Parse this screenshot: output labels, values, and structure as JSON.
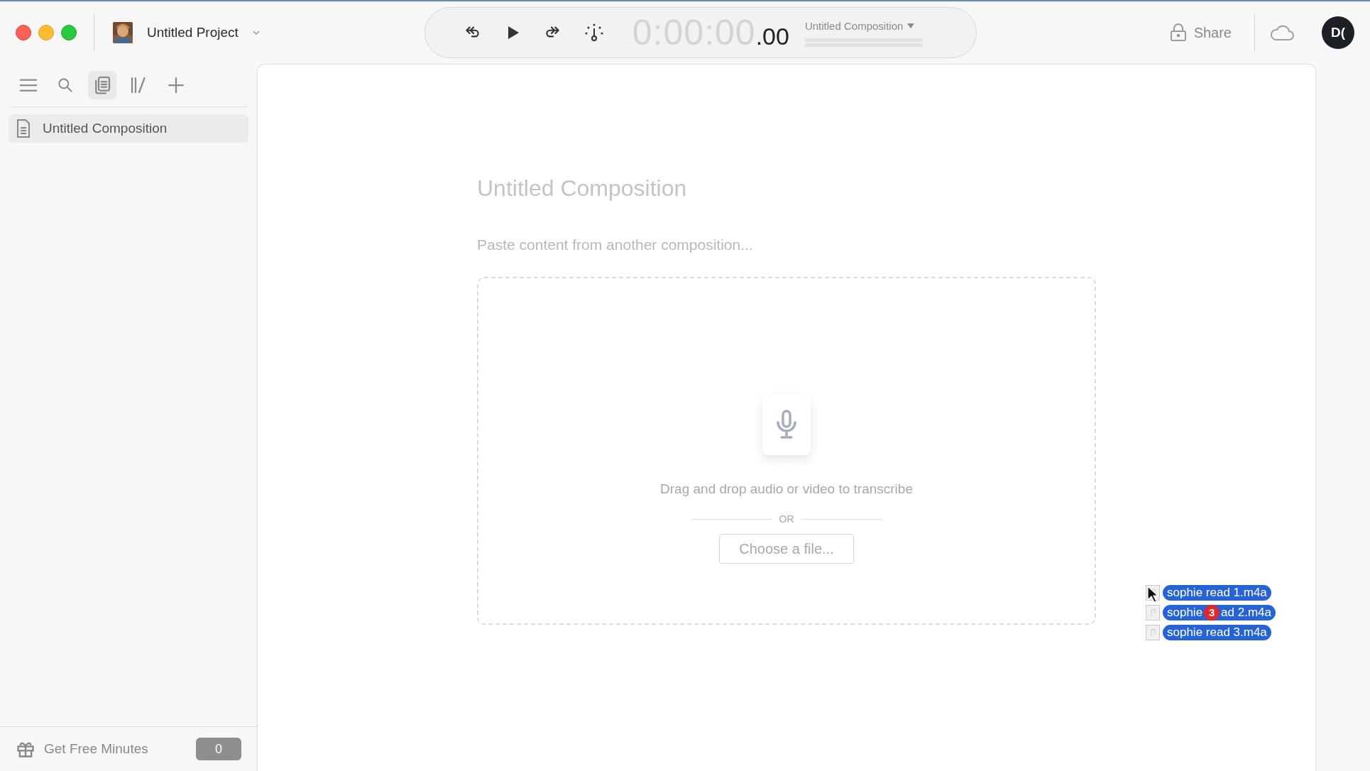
{
  "project": {
    "title": "Untitled Project"
  },
  "transport": {
    "time_main": "0:00:00",
    "time_fraction": ".00",
    "composition": "Untitled Composition"
  },
  "header": {
    "share": "Share",
    "avatar": "D("
  },
  "sidebar": {
    "tools": [
      {
        "kind": "menu",
        "selected": false
      },
      {
        "kind": "search",
        "selected": false
      },
      {
        "kind": "documents",
        "selected": true
      },
      {
        "kind": "library",
        "selected": false
      },
      {
        "kind": "add",
        "selected": false
      }
    ],
    "items": [
      {
        "label": "Untitled Composition",
        "selected": true
      }
    ],
    "footer": {
      "label": "Get Free Minutes",
      "count": "0"
    }
  },
  "editor": {
    "title": {
      "placeholder": "Untitled Composition"
    },
    "body": {
      "placeholder": "Paste content from another composition..."
    }
  },
  "dropzone": {
    "text": "Drag and drop audio or video to transcribe",
    "separator": "OR",
    "button": "Choose a file..."
  },
  "drag": {
    "count": "3",
    "files": [
      {
        "parts": [
          "sophie read 1.m4a"
        ]
      },
      {
        "parts": [
          "sophie",
          "ad 2.m4a"
        ]
      },
      {
        "parts": [
          "sophie read 3.m4a"
        ]
      }
    ]
  }
}
